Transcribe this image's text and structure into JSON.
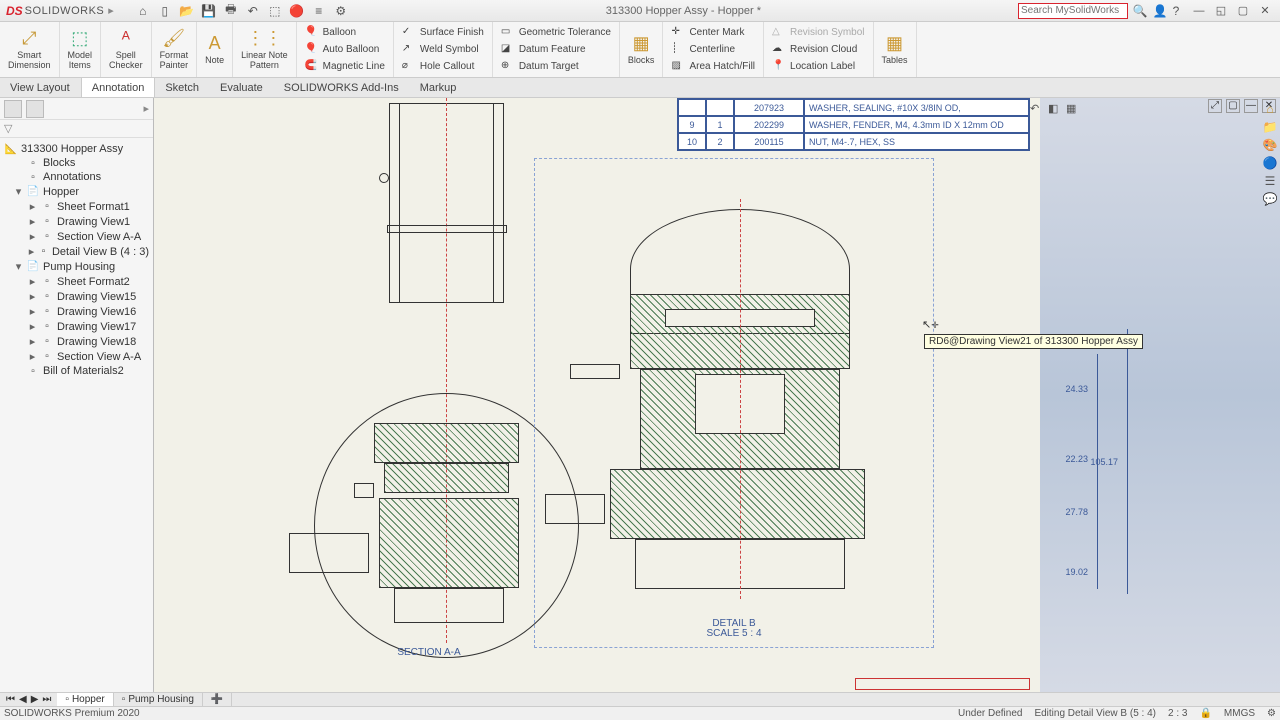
{
  "app": {
    "logo_accent": "DS",
    "logo_main": "SOLIDWORKS",
    "title": "313300 Hopper Assy - Hopper *"
  },
  "search": {
    "placeholder": "Search MySolidWorks"
  },
  "ribbon": {
    "groups": [
      {
        "label": "Smart\nDimension"
      },
      {
        "label": "Model\nItems"
      },
      {
        "label": "Spell\nChecker"
      },
      {
        "label": "Format\nPainter"
      },
      {
        "label": "Note"
      },
      {
        "label": "Linear Note\nPattern"
      }
    ],
    "col1": [
      {
        "label": "Balloon"
      },
      {
        "label": "Auto Balloon"
      },
      {
        "label": "Magnetic Line"
      }
    ],
    "col2": [
      {
        "label": "Surface Finish"
      },
      {
        "label": "Weld Symbol"
      },
      {
        "label": "Hole Callout"
      }
    ],
    "col3": [
      {
        "label": "Geometric Tolerance"
      },
      {
        "label": "Datum Feature"
      },
      {
        "label": "Datum Target"
      }
    ],
    "blocks": {
      "label": "Blocks"
    },
    "col4": [
      {
        "label": "Center Mark"
      },
      {
        "label": "Centerline"
      },
      {
        "label": "Area Hatch/Fill"
      }
    ],
    "col5": [
      {
        "label": "Revision Symbol",
        "disabled": true
      },
      {
        "label": "Revision Cloud"
      },
      {
        "label": "Location Label"
      }
    ],
    "tables": {
      "label": "Tables"
    }
  },
  "tabs": [
    "View Layout",
    "Annotation",
    "Sketch",
    "Evaluate",
    "SOLIDWORKS Add-Ins",
    "Markup"
  ],
  "tabs_active": 1,
  "tree": {
    "root": "313300 Hopper Assy",
    "items": [
      {
        "label": "Blocks",
        "ind": 1,
        "exp": ""
      },
      {
        "label": "Annotations",
        "ind": 1,
        "exp": ""
      },
      {
        "label": "Hopper",
        "ind": 1,
        "exp": "▾",
        "ico": "📄"
      },
      {
        "label": "Sheet Format1",
        "ind": 2,
        "exp": "▸"
      },
      {
        "label": "Drawing View1",
        "ind": 2,
        "exp": "▸"
      },
      {
        "label": "Section View A-A",
        "ind": 2,
        "exp": "▸"
      },
      {
        "label": "Detail View B (4 : 3)",
        "ind": 2,
        "exp": "▸"
      },
      {
        "label": "Pump Housing",
        "ind": 1,
        "exp": "▾",
        "ico": "📄"
      },
      {
        "label": "Sheet Format2",
        "ind": 2,
        "exp": "▸"
      },
      {
        "label": "Drawing View15",
        "ind": 2,
        "exp": "▸"
      },
      {
        "label": "Drawing View16",
        "ind": 2,
        "exp": "▸"
      },
      {
        "label": "Drawing View17",
        "ind": 2,
        "exp": "▸"
      },
      {
        "label": "Drawing View18",
        "ind": 2,
        "exp": "▸"
      },
      {
        "label": "Section View A-A",
        "ind": 2,
        "exp": "▸"
      },
      {
        "label": "Bill of Materials2",
        "ind": 1,
        "exp": ""
      }
    ]
  },
  "bom": {
    "rows": [
      {
        "c1": "",
        "c2": "",
        "c3": "207923",
        "desc": "WASHER, SEALING, #10X  3/8IN OD,"
      },
      {
        "c1": "9",
        "c2": "1",
        "c3": "202299",
        "desc": "WASHER, FENDER, M4, 4.3mm ID X 12mm OD"
      },
      {
        "c1": "10",
        "c2": "2",
        "c3": "200115",
        "desc": "NUT, M4-.7, HEX, SS"
      }
    ]
  },
  "drawing": {
    "section_label": "SECTION A-A",
    "detail_label": "DETAIL B",
    "detail_scale": "SCALE 5 : 4",
    "dims": {
      "d1": "24.33",
      "d2": "22.23",
      "d3": "105.17",
      "d4": "27.78",
      "d5": "19.02"
    },
    "tooltip": "RD6@Drawing View21 of 313300 Hopper Assy"
  },
  "bottom_tabs": [
    "Hopper",
    "Pump Housing"
  ],
  "bottom_active": 0,
  "status": {
    "left": "SOLIDWORKS Premium 2020",
    "defined": "Under Defined",
    "editing": "Editing Detail View B (5 : 4)",
    "scale": "2 : 3",
    "units": "MMGS"
  }
}
